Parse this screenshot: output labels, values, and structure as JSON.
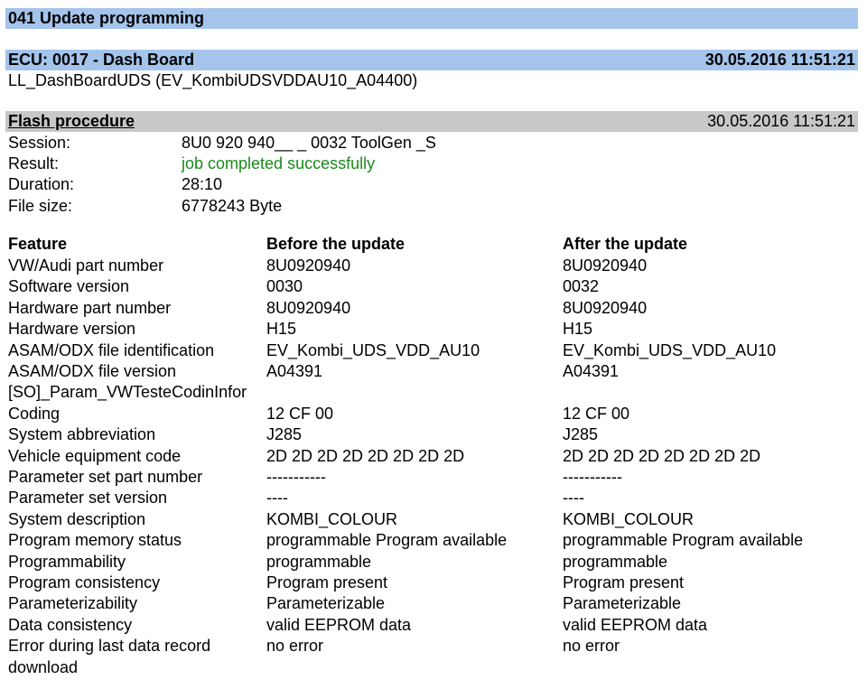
{
  "header": {
    "title": "041 Update programming"
  },
  "ecu": {
    "title": "ECU: 0017 - Dash Board",
    "timestamp": "30.05.2016 11:51:21",
    "subtitle": "LL_DashBoardUDS (EV_KombiUDSVDDAU10_A04400)"
  },
  "flash": {
    "title": "Flash procedure",
    "timestamp": "30.05.2016 11:51:21",
    "rows": [
      {
        "label": "Session:",
        "value": "8U0 920 940__ _ 0032 ToolGen _S"
      },
      {
        "label": "Result:",
        "value": "job completed successfully"
      },
      {
        "label": "Duration:",
        "value": "28:10"
      },
      {
        "label": "File size:",
        "value": "6778243 Byte"
      }
    ],
    "result_color": "#1a8a1a"
  },
  "features": {
    "headers": [
      "Feature",
      "Before the update",
      "After the update"
    ],
    "rows": [
      {
        "feature": "VW/Audi part number",
        "before": "8U0920940",
        "after": "8U0920940"
      },
      {
        "feature": "Software version",
        "before": "0030",
        "after": "0032"
      },
      {
        "feature": "Hardware part number",
        "before": "8U0920940",
        "after": "8U0920940"
      },
      {
        "feature": "Hardware version",
        "before": "H15",
        "after": "H15"
      },
      {
        "feature": "ASAM/ODX file identification",
        "before": "EV_Kombi_UDS_VDD_AU10",
        "after": "EV_Kombi_UDS_VDD_AU10"
      },
      {
        "feature": "ASAM/ODX file version",
        "before": "A04391",
        "after": "A04391"
      },
      {
        "feature": "[SO]_Param_VWTesteCodinInfor",
        "before": "",
        "after": ""
      },
      {
        "feature": "Coding",
        "before": "12 CF 00",
        "after": "12 CF 00"
      },
      {
        "feature": "System abbreviation",
        "before": "J285",
        "after": "J285"
      },
      {
        "feature": "Vehicle equipment code",
        "before": "2D 2D 2D 2D 2D 2D 2D 2D",
        "after": "2D 2D 2D 2D 2D 2D 2D 2D"
      },
      {
        "feature": "Parameter set part number",
        "before": "-----------",
        "after": "-----------"
      },
      {
        "feature": "Parameter set version",
        "before": "----",
        "after": "----"
      },
      {
        "feature": "System description",
        "before": "KOMBI_COLOUR",
        "after": "KOMBI_COLOUR"
      },
      {
        "feature": "Program memory status",
        "before": "programmable Program available",
        "after": "programmable Program available"
      },
      {
        "feature": "Programmability",
        "before": "programmable",
        "after": "programmable"
      },
      {
        "feature": "Program consistency",
        "before": "Program present",
        "after": "Program present"
      },
      {
        "feature": "Parameterizability",
        "before": "Parameterizable",
        "after": "Parameterizable"
      },
      {
        "feature": "Data consistency",
        "before": "valid EEPROM data",
        "after": "valid EEPROM data"
      },
      {
        "feature": "Error during last data record",
        "before": "no error",
        "after": "no error"
      },
      {
        "feature": "download",
        "before": "",
        "after": ""
      }
    ]
  },
  "colors": {
    "header_bar": "#a4c4ec",
    "section_bar": "#c8c8c8"
  }
}
